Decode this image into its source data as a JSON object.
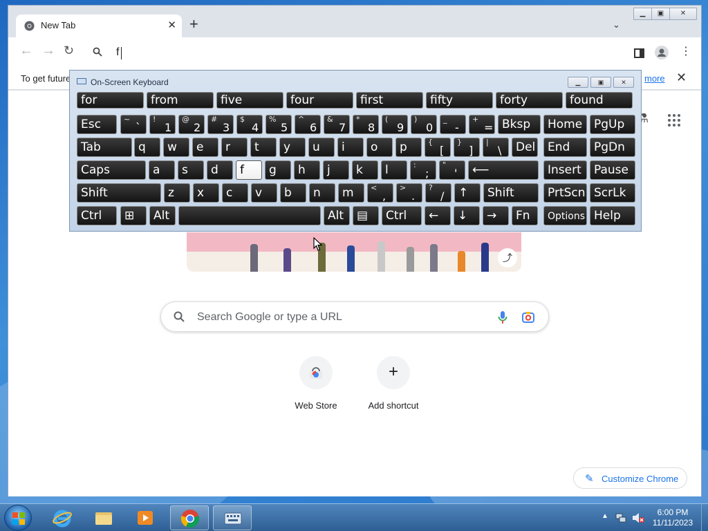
{
  "browser": {
    "tab": {
      "title": "New Tab",
      "favicon": "chrome-icon"
    },
    "toolbar": {
      "address_value": "f"
    },
    "infobar": {
      "text": "To get future",
      "link": "more"
    },
    "ntp": {
      "search_placeholder": "Search Google or type a URL",
      "shortcuts": [
        {
          "label": "Web Store",
          "icon": "web-store-icon"
        },
        {
          "label": "Add shortcut",
          "icon": "plus-icon"
        }
      ],
      "customize_label": "Customize Chrome"
    }
  },
  "osk": {
    "title": "On-Screen Keyboard",
    "suggestions": [
      "for",
      "from",
      "five",
      "four",
      "first",
      "fifty",
      "forty",
      "found"
    ],
    "rows": [
      [
        {
          "m": "Esc"
        },
        {
          "s": "~",
          "b": "`"
        },
        {
          "s": "!",
          "b": "1"
        },
        {
          "s": "@",
          "b": "2"
        },
        {
          "s": "#",
          "b": "3"
        },
        {
          "s": "$",
          "b": "4"
        },
        {
          "s": "%",
          "b": "5"
        },
        {
          "s": "^",
          "b": "6"
        },
        {
          "s": "&",
          "b": "7"
        },
        {
          "s": "*",
          "b": "8"
        },
        {
          "s": "(",
          "b": "9"
        },
        {
          "s": ")",
          "b": "0"
        },
        {
          "s": "_",
          "b": "-"
        },
        {
          "s": "+",
          "b": "="
        },
        {
          "m": "Bksp"
        },
        {
          "m": "Home"
        },
        {
          "m": "PgUp"
        }
      ],
      [
        {
          "m": "Tab"
        },
        {
          "m": "q"
        },
        {
          "m": "w"
        },
        {
          "m": "e"
        },
        {
          "m": "r"
        },
        {
          "m": "t"
        },
        {
          "m": "y"
        },
        {
          "m": "u"
        },
        {
          "m": "i"
        },
        {
          "m": "o"
        },
        {
          "m": "p"
        },
        {
          "s": "{",
          "b": "["
        },
        {
          "s": "}",
          "b": "]"
        },
        {
          "s": "|",
          "b": "\\"
        },
        {
          "m": "Del"
        },
        {
          "m": "End"
        },
        {
          "m": "PgDn"
        }
      ],
      [
        {
          "m": "Caps"
        },
        {
          "m": "a"
        },
        {
          "m": "s"
        },
        {
          "m": "d"
        },
        {
          "m": "f",
          "active": true
        },
        {
          "m": "g"
        },
        {
          "m": "h"
        },
        {
          "m": "j"
        },
        {
          "m": "k"
        },
        {
          "m": "l"
        },
        {
          "s": ":",
          "b": ";"
        },
        {
          "s": "\"",
          "b": "'"
        },
        {
          "m": "⟵"
        },
        {
          "m": "Insert"
        },
        {
          "m": "Pause"
        }
      ],
      [
        {
          "m": "Shift"
        },
        {
          "m": "z"
        },
        {
          "m": "x"
        },
        {
          "m": "c"
        },
        {
          "m": "v"
        },
        {
          "m": "b"
        },
        {
          "m": "n"
        },
        {
          "m": "m"
        },
        {
          "s": "<",
          "b": ","
        },
        {
          "s": ">",
          "b": "."
        },
        {
          "s": "?",
          "b": "/"
        },
        {
          "m": "↑"
        },
        {
          "m": "Shift"
        },
        {
          "m": "PrtScn"
        },
        {
          "m": "ScrLk"
        }
      ],
      [
        {
          "m": "Ctrl"
        },
        {
          "m": "⊞"
        },
        {
          "m": "Alt"
        },
        {
          "m": ""
        },
        {
          "m": "Alt"
        },
        {
          "m": "▤"
        },
        {
          "m": "Ctrl"
        },
        {
          "m": "←"
        },
        {
          "m": "↓"
        },
        {
          "m": "→"
        },
        {
          "m": "Fn"
        },
        {
          "m": "Options",
          "small": true
        },
        {
          "m": "Help"
        }
      ]
    ]
  },
  "taskbar": {
    "time": "6:00 PM",
    "date": "11/11/2023",
    "apps": [
      "internet-explorer-icon",
      "folder-icon",
      "media-player-icon",
      "chrome-icon",
      "on-screen-keyboard-icon"
    ]
  },
  "colors": {
    "accent": "#1a73e8",
    "key_bg": "#1a1a1a",
    "desktop": "#2a78cc"
  }
}
